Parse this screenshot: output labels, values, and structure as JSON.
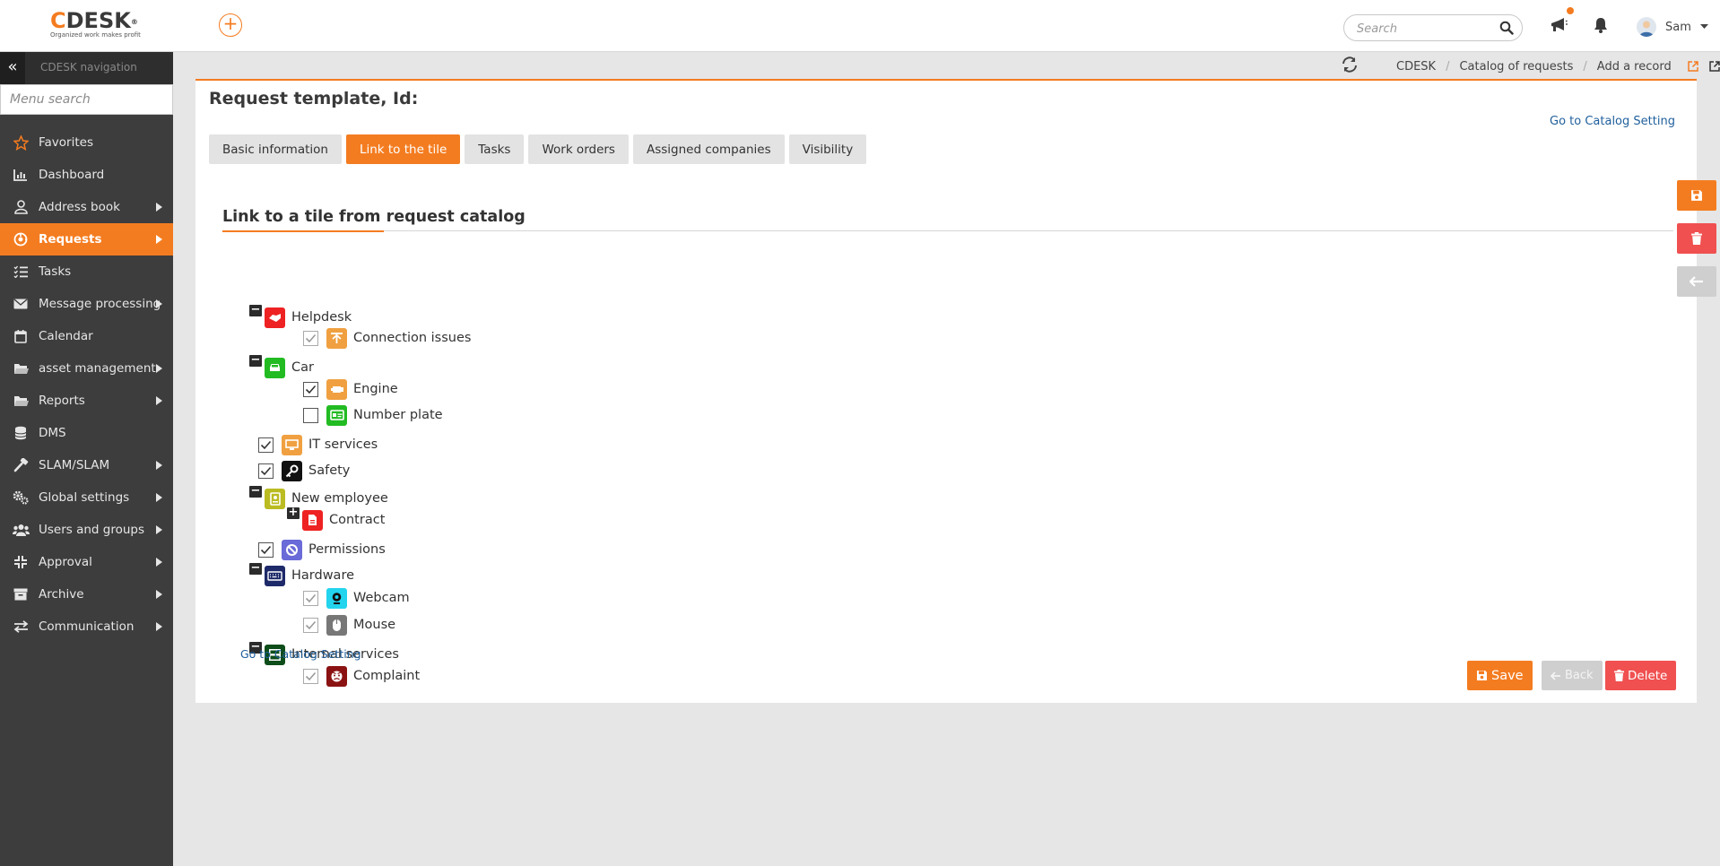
{
  "header": {
    "logo": {
      "brand": "CDESK",
      "reg": "®",
      "tagline": "Organized work makes profit"
    },
    "search_placeholder": "Search",
    "user_name": "Sam"
  },
  "sidebar": {
    "title": "CDESK navigation",
    "search_placeholder": "Menu search",
    "items": [
      {
        "label": "Favorites",
        "icon": "star-icon",
        "arrow": false
      },
      {
        "label": "Dashboard",
        "icon": "dashboard-icon",
        "arrow": false
      },
      {
        "label": "Address book",
        "icon": "user-icon",
        "arrow": true
      },
      {
        "label": "Requests",
        "icon": "requests-icon",
        "arrow": true,
        "active": true
      },
      {
        "label": "Tasks",
        "icon": "tasks-icon",
        "arrow": false
      },
      {
        "label": "Message processing",
        "icon": "envelope-icon",
        "arrow": true
      },
      {
        "label": "Calendar",
        "icon": "calendar-icon",
        "arrow": false
      },
      {
        "label": "asset management",
        "icon": "folder-icon",
        "arrow": true
      },
      {
        "label": "Reports",
        "icon": "folder-open-icon",
        "arrow": true
      },
      {
        "label": "DMS",
        "icon": "database-icon",
        "arrow": false
      },
      {
        "label": "SLAM/SLAM",
        "icon": "hammer-icon",
        "arrow": true
      },
      {
        "label": "Global settings",
        "icon": "gears-icon",
        "arrow": true
      },
      {
        "label": "Users and groups",
        "icon": "users-icon",
        "arrow": true
      },
      {
        "label": "Approval",
        "icon": "compress-icon",
        "arrow": true
      },
      {
        "label": "Archive",
        "icon": "archive-icon",
        "arrow": true
      },
      {
        "label": "Communication",
        "icon": "exchange-icon",
        "arrow": true
      }
    ]
  },
  "breadcrumb": [
    "CDESK",
    "Catalog of requests",
    "Add a record"
  ],
  "page": {
    "title": "Request template, Id:",
    "goto_catalog": "Go to Catalog Setting",
    "tabs": [
      {
        "label": "Basic information",
        "active": false
      },
      {
        "label": "Link to the tile",
        "active": true
      },
      {
        "label": "Tasks",
        "active": false
      },
      {
        "label": "Work orders",
        "active": false
      },
      {
        "label": "Assigned companies",
        "active": false
      },
      {
        "label": "Visibility",
        "active": false
      }
    ],
    "section_title": "Link to a tile from request catalog"
  },
  "tree": [
    {
      "label": "Helpdesk",
      "toggle": "minus",
      "checkbox": "none",
      "color": "#ee2222",
      "icon": "handshake-icon"
    },
    {
      "label": "Connection issues",
      "toggle": "none",
      "checkbox": "checked-disabled",
      "color": "#f0a040",
      "icon": "network-icon"
    },
    {
      "label": "Car",
      "toggle": "minus",
      "checkbox": "none",
      "color": "#22bb22",
      "icon": "car-icon"
    },
    {
      "label": "Engine",
      "toggle": "none",
      "checkbox": "checked",
      "color": "#f0a040",
      "icon": "engine-icon"
    },
    {
      "label": "Number plate",
      "toggle": "none",
      "checkbox": "unchecked",
      "color": "#22bb22",
      "icon": "id-card-icon"
    },
    {
      "label": "IT services",
      "toggle": "none",
      "checkbox": "checked",
      "color": "#f0a040",
      "icon": "monitor-icon"
    },
    {
      "label": "Safety",
      "toggle": "none",
      "checkbox": "checked",
      "color": "#111111",
      "icon": "key-icon"
    },
    {
      "label": "New employee",
      "toggle": "minus",
      "checkbox": "none",
      "color": "#bbbb22",
      "icon": "badge-icon"
    },
    {
      "label": "Contract",
      "toggle": "plus",
      "checkbox": "none",
      "color": "#ee2222",
      "icon": "file-icon"
    },
    {
      "label": "Permissions",
      "toggle": "none",
      "checkbox": "checked",
      "color": "#6a6ad8",
      "icon": "ban-icon"
    },
    {
      "label": "Hardware",
      "toggle": "minus",
      "checkbox": "none",
      "color": "#1e2a6a",
      "icon": "keyboard-icon"
    },
    {
      "label": "Webcam",
      "toggle": "none",
      "checkbox": "checked-disabled",
      "color": "#22d4ee",
      "icon": "webcam-icon"
    },
    {
      "label": "Mouse",
      "toggle": "none",
      "checkbox": "checked-disabled",
      "color": "#777777",
      "icon": "mouse-icon"
    },
    {
      "label": "Internal services",
      "toggle": "minus",
      "checkbox": "none",
      "color": "#0d4d1a",
      "icon": "server-icon"
    },
    {
      "label": "Complaint",
      "toggle": "none",
      "checkbox": "checked-disabled",
      "color": "#8b1212",
      "icon": "angry-face-icon"
    }
  ],
  "buttons": {
    "save": "Save",
    "back": "Back",
    "delete": "Delete"
  },
  "colors": {
    "accent": "#f47c20",
    "danger": "#f05050",
    "muted": "#cfcfcf",
    "sidebar": "#3d3d3d",
    "link": "#1f5f9c"
  }
}
